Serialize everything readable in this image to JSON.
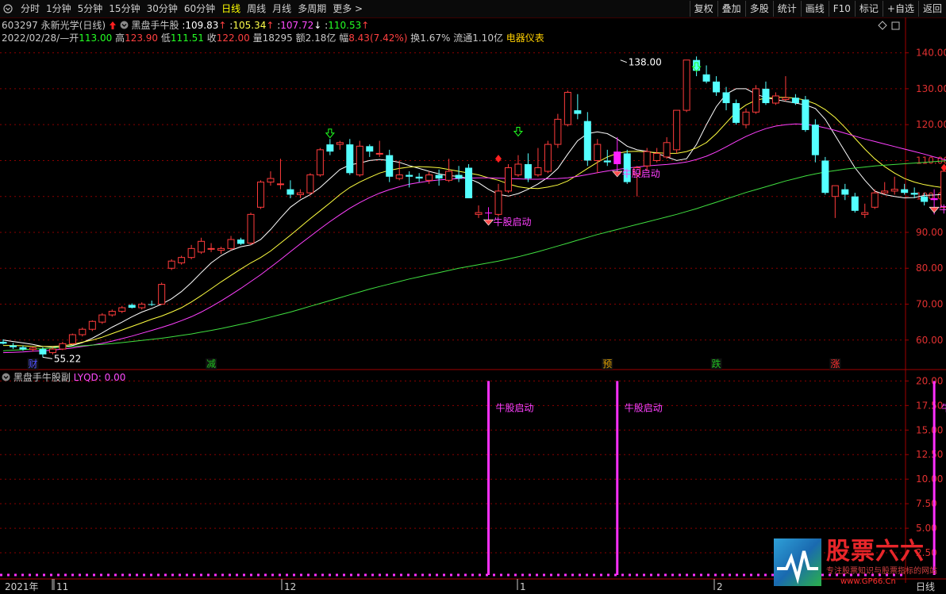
{
  "toolbar": {
    "periods": [
      "分时",
      "1分钟",
      "5分钟",
      "15分钟",
      "30分钟",
      "60分钟",
      "日线",
      "周线",
      "月线",
      "多周期",
      "更多"
    ],
    "more_arrow": ">",
    "active": "日线",
    "buttons": [
      "复权",
      "叠加",
      "多股",
      "统计",
      "画线",
      "F10",
      "标记",
      "+自选",
      "返回"
    ]
  },
  "stock": {
    "code": "603297",
    "name": "永新光学",
    "period": "(日线)",
    "indicator": "黑盘手牛股",
    "v1": "109.83",
    "v2": "105.34",
    "v3": "107.72",
    "v4": "110.53",
    "arrow_up": "↑",
    "arrow_down": "↓"
  },
  "quote": {
    "date": "2022/02/28/—",
    "open_label": "开",
    "open": "113.00",
    "high_label": "高",
    "high": "123.90",
    "low_label": "低",
    "low": "111.51",
    "close_label": "收",
    "close": "122.00",
    "vol_label": "量",
    "vol": "18295",
    "amt_label": "额",
    "amt": "2.18亿",
    "chg_label": "幅",
    "chg": "8.43(7.42%)",
    "turn_label": "换",
    "turn": "1.67%",
    "float_label": "流通",
    "float": "1.10亿",
    "sector": "电器仪表"
  },
  "sub_chart": {
    "title": "黑盘手牛股副",
    "label": "LYQD:",
    "value": "0.00"
  },
  "markers": {
    "high_price": "138.00",
    "low_price": "55.22",
    "signal": "牛股启动",
    "events": [
      "财",
      "减",
      "预",
      "跌",
      "涨"
    ]
  },
  "xaxis": [
    "2021年",
    "11",
    "12",
    "1",
    "2"
  ],
  "xaxis_right": "日线",
  "watermark": {
    "title": "股票六六",
    "sub": "专注股票知识与股票指标的网站",
    "url": "www.GP66.Cn"
  },
  "chart_data": {
    "type": "candlestick",
    "main_axis": {
      "ylim": [
        52,
        145
      ],
      "ticks": [
        "140.00",
        "130.00",
        "120.00",
        "110.00",
        "100.00",
        "90.00",
        "80.00",
        "70.00",
        "60.00"
      ]
    },
    "sub_axis": {
      "ylim": [
        0,
        21
      ],
      "ticks": [
        "20.00",
        "17.50",
        "15.00",
        "12.50",
        "10.00",
        "7.50",
        "5.00",
        "2.50"
      ]
    },
    "candles": [
      [
        59.5,
        60.2,
        58.8,
        59.0
      ],
      [
        58.5,
        59.2,
        57.5,
        58.0
      ],
      [
        58.0,
        58.5,
        57.0,
        57.4
      ],
      [
        57.4,
        58.2,
        56.8,
        57.8
      ],
      [
        57.5,
        58.0,
        55.2,
        56.0
      ],
      [
        56.5,
        58.0,
        56.0,
        57.5
      ],
      [
        57.5,
        59.5,
        57.2,
        59.0
      ],
      [
        59.0,
        61.8,
        58.8,
        61.5
      ],
      [
        61.5,
        63.5,
        61.0,
        63.0
      ],
      [
        63.0,
        65.5,
        62.5,
        65.2
      ],
      [
        65.0,
        67.5,
        64.5,
        67.0
      ],
      [
        67.0,
        68.5,
        66.5,
        68.0
      ],
      [
        68.0,
        69.5,
        67.5,
        69.0
      ],
      [
        69.8,
        70.2,
        68.8,
        69.0
      ],
      [
        69.0,
        70.5,
        68.5,
        70.0
      ],
      [
        70.0,
        71.0,
        69.5,
        69.8
      ],
      [
        70.0,
        76.0,
        69.8,
        75.5
      ],
      [
        80.0,
        82.5,
        79.5,
        82.0
      ],
      [
        81.5,
        83.5,
        81.0,
        83.0
      ],
      [
        83.0,
        86.5,
        82.5,
        85.5
      ],
      [
        84.5,
        88.5,
        84.0,
        87.5
      ],
      [
        85.5,
        87.0,
        84.5,
        85.5
      ],
      [
        85.0,
        86.0,
        84.0,
        85.5
      ],
      [
        85.5,
        89.0,
        85.0,
        88.0
      ],
      [
        88.0,
        88.5,
        86.5,
        86.8
      ],
      [
        87.0,
        95.5,
        86.5,
        95.0
      ],
      [
        97.0,
        104.5,
        96.5,
        104.0
      ],
      [
        104.0,
        107.0,
        103.0,
        105.0
      ],
      [
        103.5,
        110.5,
        102.0,
        103.5
      ],
      [
        102.0,
        104.5,
        99.5,
        100.5
      ],
      [
        100.5,
        102.0,
        99.5,
        101.0
      ],
      [
        101.0,
        106.5,
        100.5,
        106.0
      ],
      [
        106.0,
        113.5,
        105.5,
        113.0
      ],
      [
        114.5,
        116.0,
        111.5,
        112.5
      ],
      [
        114.5,
        115.5,
        113.0,
        115.0
      ],
      [
        114.5,
        116.0,
        106.0,
        106.5
      ],
      [
        106.0,
        115.5,
        105.5,
        114.0
      ],
      [
        114.0,
        114.5,
        111.0,
        112.5
      ],
      [
        112.0,
        115.5,
        111.0,
        112.0
      ],
      [
        111.5,
        113.0,
        104.0,
        105.5
      ],
      [
        105.0,
        110.0,
        104.5,
        106.0
      ],
      [
        106.0,
        107.0,
        102.5,
        105.5
      ],
      [
        105.5,
        106.5,
        104.0,
        105.0
      ],
      [
        104.5,
        107.0,
        103.5,
        106.0
      ],
      [
        106.0,
        107.5,
        103.0,
        105.0
      ],
      [
        104.5,
        110.5,
        104.0,
        107.0
      ],
      [
        106.0,
        108.5,
        104.0,
        105.0
      ],
      [
        108.0,
        109.0,
        99.5,
        99.5
      ],
      [
        95.0,
        97.5,
        94.0,
        95.5
      ],
      [
        95.5,
        97.0,
        93.5,
        95.5
      ],
      [
        95.0,
        103.5,
        94.5,
        101.5
      ],
      [
        101.5,
        109.0,
        101.0,
        108.0
      ],
      [
        106.0,
        111.5,
        105.5,
        109.0
      ],
      [
        109.0,
        112.0,
        104.0,
        105.0
      ],
      [
        106.0,
        113.5,
        105.5,
        108.0
      ],
      [
        107.0,
        115.5,
        106.5,
        114.5
      ],
      [
        114.5,
        123.0,
        113.5,
        121.5
      ],
      [
        120.0,
        129.5,
        119.5,
        129.0
      ],
      [
        124.0,
        128.5,
        121.5,
        123.0
      ],
      [
        121.0,
        123.5,
        108.5,
        110.0
      ],
      [
        110.0,
        116.0,
        106.5,
        114.5
      ],
      [
        110.0,
        113.0,
        108.5,
        109.5
      ],
      [
        109.0,
        116.5,
        106.0,
        112.5
      ],
      [
        112.0,
        113.0,
        103.5,
        104.0
      ],
      [
        106.0,
        108.5,
        100.0,
        108.0
      ],
      [
        108.5,
        113.5,
        107.0,
        112.5
      ],
      [
        110.0,
        113.5,
        109.5,
        112.0
      ],
      [
        111.0,
        116.5,
        110.5,
        115.0
      ],
      [
        113.0,
        124.0,
        112.0,
        124.0
      ],
      [
        124.0,
        138.0,
        123.5,
        138.0
      ],
      [
        138.0,
        139.0,
        133.5,
        135.0
      ],
      [
        134.0,
        136.5,
        131.5,
        132.0
      ],
      [
        132.0,
        133.5,
        128.0,
        129.0
      ],
      [
        129.0,
        130.5,
        124.0,
        126.0
      ],
      [
        126.0,
        127.0,
        120.0,
        120.5
      ],
      [
        120.0,
        124.5,
        119.0,
        123.5
      ],
      [
        123.5,
        131.0,
        123.0,
        130.0
      ],
      [
        130.0,
        132.0,
        125.5,
        126.0
      ],
      [
        126.0,
        129.0,
        125.5,
        128.0
      ],
      [
        127.0,
        133.5,
        126.5,
        127.5
      ],
      [
        127.5,
        128.5,
        125.5,
        126.0
      ],
      [
        127.0,
        128.0,
        118.0,
        118.5
      ],
      [
        120.0,
        121.5,
        109.5,
        111.5
      ],
      [
        110.0,
        111.0,
        100.5,
        101.0
      ],
      [
        100.0,
        103.0,
        94.0,
        103.0
      ],
      [
        102.0,
        103.5,
        99.0,
        100.5
      ],
      [
        100.0,
        101.0,
        95.5,
        96.0
      ],
      [
        95.0,
        98.0,
        94.0,
        95.5
      ],
      [
        97.0,
        102.0,
        96.5,
        101.0
      ],
      [
        101.0,
        104.0,
        100.5,
        101.5
      ],
      [
        101.5,
        105.5,
        100.5,
        102.0
      ],
      [
        102.0,
        103.5,
        100.5,
        101.0
      ],
      [
        101.0,
        102.5,
        99.5,
        100.5
      ],
      [
        100.0,
        101.0,
        97.5,
        98.5
      ],
      [
        99.0,
        102.0,
        95.0,
        99.5
      ],
      [
        97.0,
        107.0,
        96.5,
        107.0
      ],
      [
        107.0,
        109.5,
        106.5,
        108.0
      ],
      [
        108.0,
        115.5,
        107.0,
        113.5
      ],
      [
        113.0,
        123.9,
        111.51,
        122.0
      ]
    ],
    "ma_series": [
      {
        "color": "#ffffff",
        "values": [
          60,
          59.6,
          59.2,
          58.8,
          58.2,
          58,
          58,
          58.5,
          59.3,
          60.5,
          62,
          63.6,
          65,
          66.5,
          67.8,
          68.8,
          70,
          71.5,
          73.5,
          76,
          78.8,
          81.5,
          83.5,
          85,
          86,
          86.5,
          88,
          90.8,
          94,
          97,
          99,
          100.5,
          102.5,
          105,
          107.5,
          108.8,
          109.3,
          110,
          110.3,
          110,
          109.5,
          108.6,
          107.8,
          107,
          106.3,
          105.8,
          105.6,
          105,
          103.8,
          102,
          100.6,
          100.1,
          100.8,
          102,
          103.5,
          105.3,
          107.8,
          111.8,
          115.5,
          117.5,
          118,
          117.5,
          116,
          114,
          113,
          112.6,
          112,
          111,
          110,
          110.5,
          114.5,
          120,
          125,
          128.5,
          130,
          130,
          128.5,
          127.5,
          127,
          126.5,
          126,
          125.5,
          124.5,
          121.5,
          117,
          112.5,
          108,
          104.5,
          101.5,
          100.5,
          100,
          99.6,
          99.7,
          100.3,
          100.4,
          100.6,
          101,
          103,
          106.5
        ]
      },
      {
        "color": "#ffff40",
        "values": [
          58.5,
          58.5,
          58.4,
          58.2,
          58.2,
          58.2,
          58.4,
          58.8,
          59.4,
          60,
          60.8,
          61.8,
          62.8,
          63.8,
          64.8,
          65.8,
          66.7,
          67.8,
          69,
          70.6,
          72.4,
          74.3,
          76.2,
          78,
          79.8,
          81.5,
          83,
          84.8,
          87,
          89.2,
          91.5,
          93.8,
          96,
          98.2,
          100.5,
          102.5,
          104,
          105.3,
          106.5,
          107.3,
          107.8,
          108.2,
          108.3,
          108.2,
          108,
          107.5,
          107,
          106.5,
          106,
          105.2,
          104.5,
          103.5,
          102.7,
          102.3,
          102.2,
          102.6,
          103.2,
          104.3,
          106,
          107.8,
          109.5,
          111,
          112,
          112.5,
          112.6,
          112.4,
          112.2,
          112,
          112,
          112.5,
          113.5,
          115,
          117.5,
          120.5,
          123.5,
          125.5,
          126.8,
          127.4,
          127.6,
          127.6,
          127.4,
          126.8,
          125.8,
          124.2,
          122,
          119.2,
          116.2,
          113.2,
          110.5,
          108.3,
          106.5,
          105,
          104,
          103.3,
          102.8,
          102.4,
          102.3,
          102.6,
          103.8
        ]
      },
      {
        "color": "#ff40ff",
        "values": [
          56.5,
          56.6,
          56.7,
          56.9,
          57,
          57.2,
          57.5,
          57.8,
          58.2,
          58.6,
          59.1,
          59.7,
          60.4,
          61.1,
          61.9,
          62.7,
          63.5,
          64.4,
          65.4,
          66.5,
          67.8,
          69.3,
          70.9,
          72.6,
          74.4,
          76.3,
          78.2,
          80.3,
          82.4,
          84.6,
          86.8,
          88.9,
          91,
          93,
          94.9,
          96.7,
          98.3,
          99.7,
          100.9,
          101.9,
          102.7,
          103.4,
          103.9,
          104.3,
          104.6,
          104.8,
          105,
          105.1,
          105.2,
          105.2,
          105.1,
          105,
          104.9,
          104.8,
          104.8,
          104.9,
          105,
          105.2,
          105.6,
          106.1,
          106.6,
          107.1,
          107.5,
          107.9,
          108.2,
          108.5,
          108.7,
          108.9,
          109.2,
          109.6,
          110.3,
          111.2,
          112.4,
          113.8,
          115.3,
          116.7,
          117.9,
          118.9,
          119.6,
          120,
          120.2,
          120.1,
          119.7,
          119.1,
          118.4,
          117.6,
          116.8,
          116,
          115.3,
          114.6,
          113.9,
          113.2,
          112.5,
          111.8,
          111,
          110.3,
          109.6,
          109,
          108.6
        ]
      },
      {
        "color": "#40e040",
        "values": [
          57,
          57.2,
          57.3,
          57.5,
          57.6,
          57.8,
          58,
          58.2,
          58.4,
          58.6,
          58.8,
          59,
          59.3,
          59.6,
          59.9,
          60.2,
          60.5,
          60.9,
          61.3,
          61.7,
          62.2,
          62.7,
          63.2,
          63.8,
          64.4,
          65,
          65.7,
          66.4,
          67.1,
          67.8,
          68.6,
          69.4,
          70.2,
          71,
          71.8,
          72.6,
          73.4,
          74.2,
          74.9,
          75.6,
          76.3,
          77,
          77.6,
          78.2,
          78.8,
          79.4,
          80,
          80.5,
          81,
          81.5,
          82,
          82.6,
          83.2,
          83.9,
          84.6,
          85.4,
          86.2,
          87,
          87.8,
          88.6,
          89.4,
          90.1,
          90.8,
          91.5,
          92.2,
          92.9,
          93.6,
          94.3,
          95,
          95.8,
          96.6,
          97.5,
          98.4,
          99.3,
          100.2,
          101.1,
          101.9,
          102.7,
          103.5,
          104.3,
          105,
          105.7,
          106.3,
          106.8,
          107.2,
          107.6,
          107.9,
          108.2,
          108.5,
          108.7,
          108.9,
          109.1,
          109.3,
          109.5,
          109.7,
          109.9,
          110,
          110.2,
          110.4
        ]
      }
    ],
    "signals": [
      {
        "index": 49,
        "type": "牛股启动"
      },
      {
        "index": 62,
        "type": "牛股启动"
      },
      {
        "index": 94,
        "type": "牛股启动"
      }
    ],
    "sub_series": {
      "name": "LYQD",
      "values": [
        20,
        20,
        20
      ]
    }
  }
}
